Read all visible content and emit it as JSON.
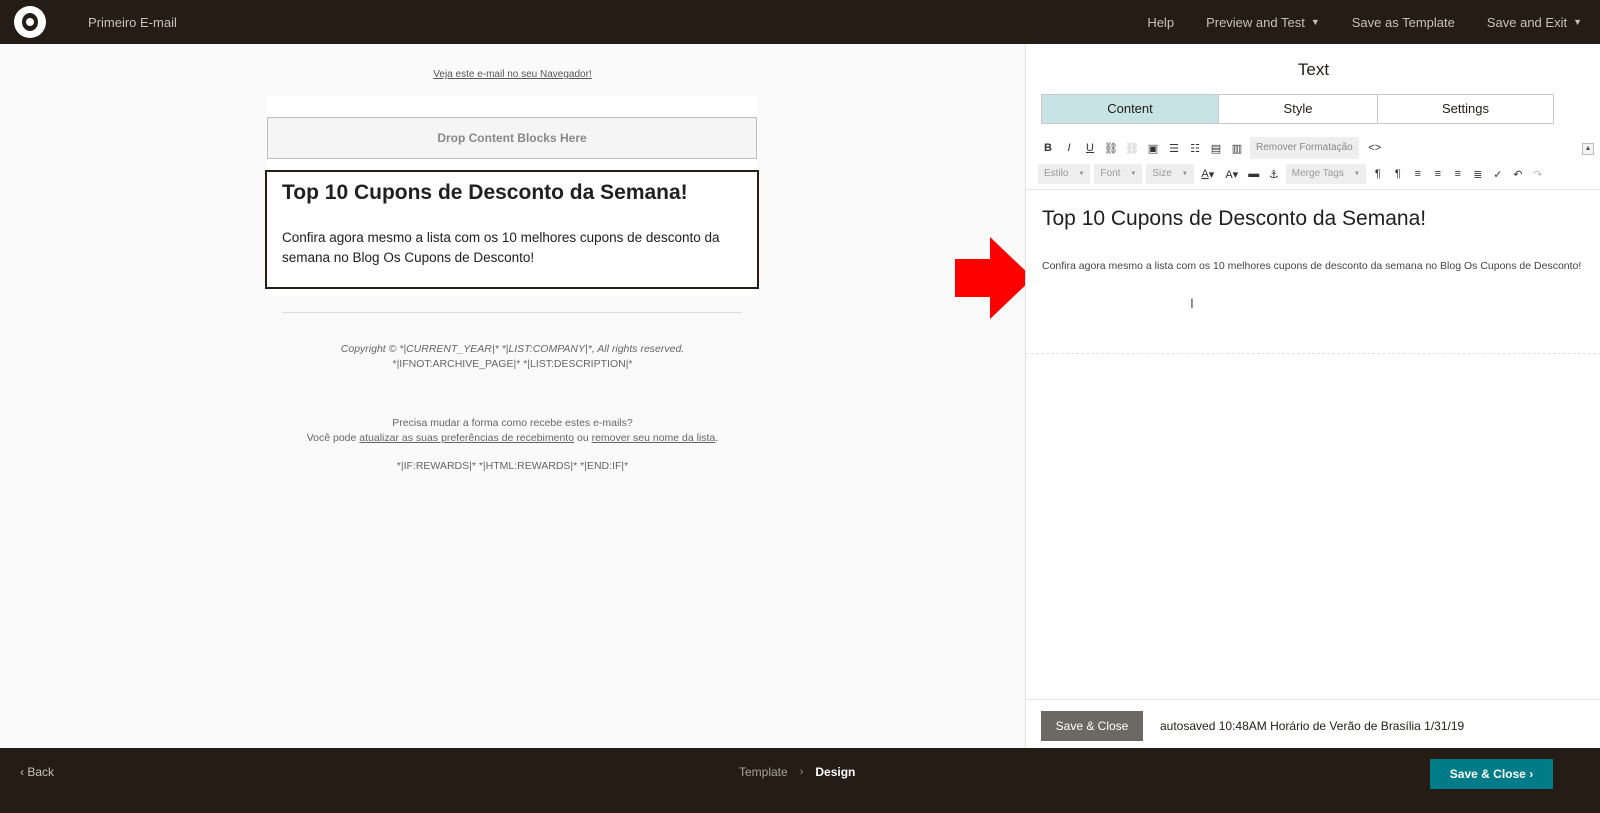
{
  "topbar": {
    "campaign_name": "Primeiro E-mail",
    "help": "Help",
    "preview_test": "Preview and Test",
    "save_template": "Save as Template",
    "save_exit": "Save and Exit"
  },
  "preview": {
    "view_in_browser": "Veja este e-mail no seu Navegador!",
    "drop_zone": "Drop Content Blocks Here",
    "headline": "Top 10 Cupons de Desconto da Semana!",
    "body": "Confira agora mesmo a lista com os 10 melhores cupons de desconto da semana no Blog Os Cupons de Desconto!",
    "copyright": "Copyright © *|CURRENT_YEAR|* *|LIST:COMPANY|*, All rights reserved.",
    "archive": "*|IFNOT:ARCHIVE_PAGE|* *|LIST:DESCRIPTION|*",
    "prefs_question": "Precisa mudar a forma como recebe estes e-mails?",
    "prefs_prefix": "Você pode ",
    "prefs_update_link": "atualizar as suas preferências de recebimento",
    "prefs_or": " ou ",
    "prefs_remove_link": "remover seu nome da lista",
    "prefs_suffix": ".",
    "rewards": "*|IF:REWARDS|* *|HTML:REWARDS|* *|END:IF|*"
  },
  "panel": {
    "title": "Text",
    "tabs": [
      "Content",
      "Style",
      "Settings"
    ],
    "remove_formatting": "Remover Formatação",
    "combo_style": "Estilo",
    "combo_font": "Font",
    "combo_size": "Size",
    "combo_merge": "Merge Tags",
    "editor_headline": "Top 10 Cupons de Desconto da Semana!",
    "editor_body": "Confira agora mesmo a lista com os 10 melhores cupons de desconto da semana no Blog Os Cupons de Desconto!",
    "save_close": "Save & Close",
    "autosave": "autosaved 10:48AM Horário de Verão de Brasília 1/31/19"
  },
  "bottombar": {
    "back": "Back",
    "crumb_template": "Template",
    "crumb_design": "Design",
    "save_close": "Save & Close"
  },
  "colors": {
    "dark": "#241c15",
    "teal": "#007c89",
    "tab_active": "#c7e3e6",
    "arrow": "#ff0000"
  }
}
